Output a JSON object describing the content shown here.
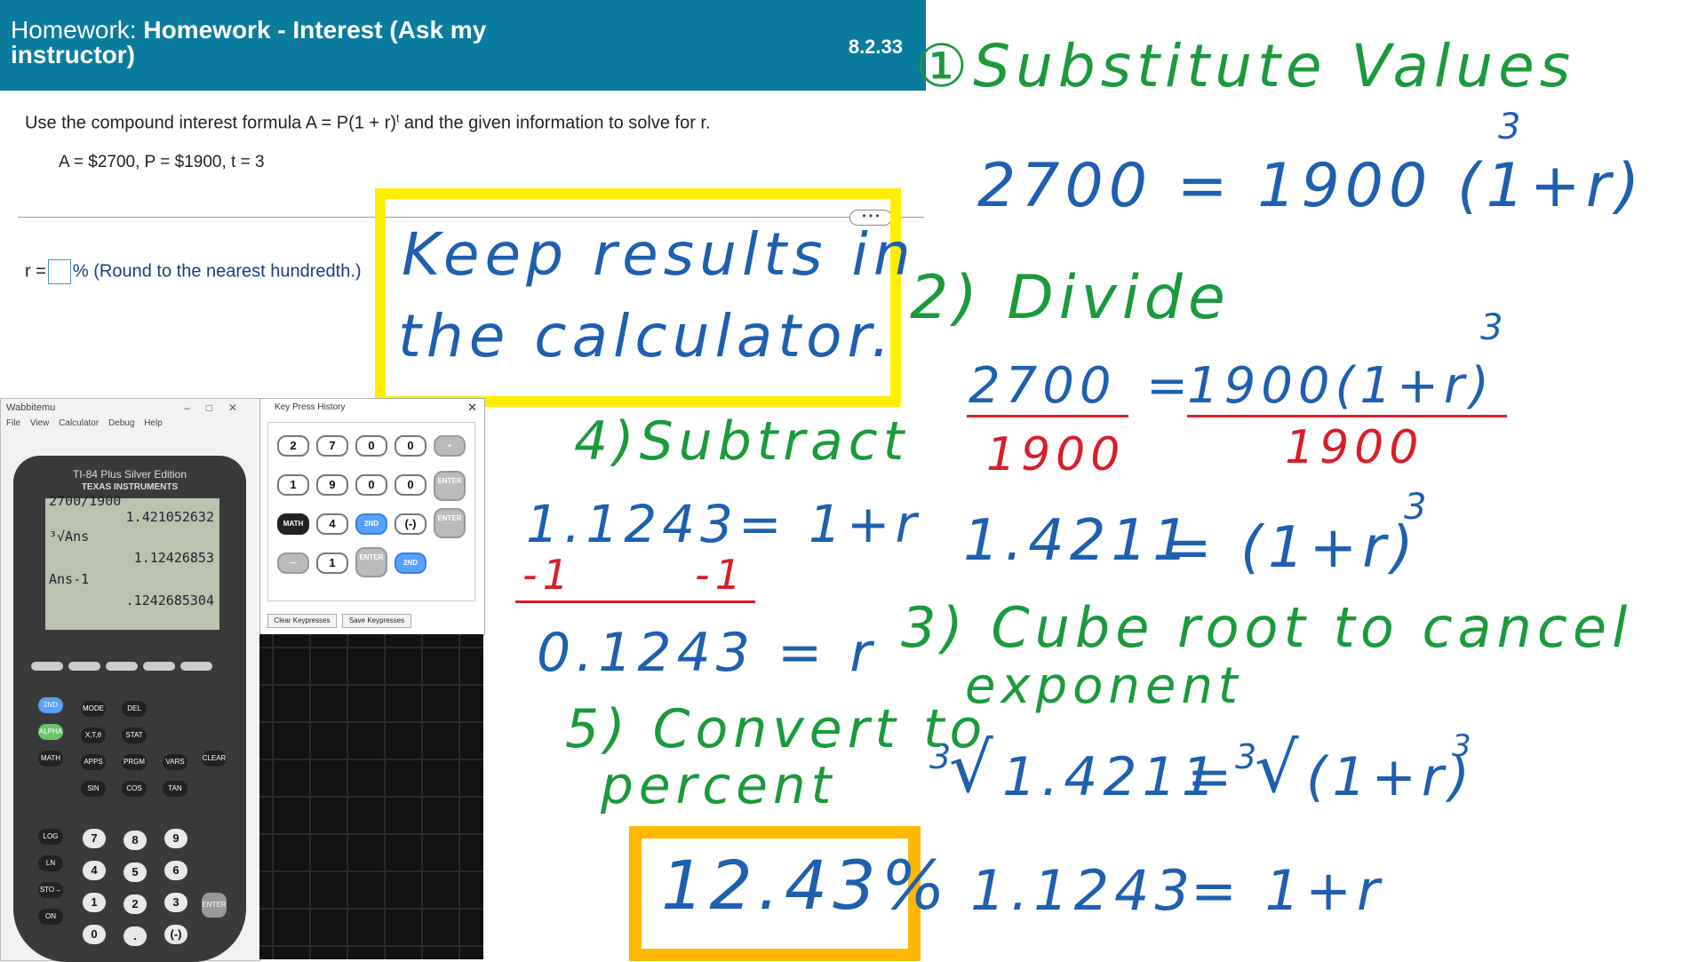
{
  "homework": {
    "label": "Homework:",
    "title_line1": "Homework - Interest (Ask my",
    "title_line2": "instructor)",
    "id": "8.2.33",
    "question_pre": "Use the compound interest formula A = P(1 + r)",
    "question_exp": "t",
    "question_post": " and the given information to solve for r.",
    "given": "A = $2700, P = $1900, t = 3",
    "more": "• • •",
    "answer_prefix": "r =",
    "answer_hint": "% (Round to the nearest hundredth.)"
  },
  "notes": {
    "step1": "①Substitute Values",
    "eq1": "2700 = 1900 (1+r)",
    "eq1_exp": "3",
    "step2": "2) Divide",
    "div_num_left": "2700",
    "div_den_left": "1900",
    "div_num_right": "1900(1+r)",
    "div_num_right_exp": "3",
    "div_den_right": "1900",
    "eq2_left": "1.4211",
    "eq2_right": "= (1+r)",
    "eq2_exp": "3",
    "step3_line1": "3) Cube root to cancel",
    "step3_line2": "exponent",
    "root_index": "3",
    "root_left": "1.4211",
    "root_eq": "=",
    "root_right": "(1+r)",
    "root_right_exp": "3",
    "eq3_left": "1.1243",
    "eq3_right": "= 1+r",
    "keep_line1": "Keep results in",
    "keep_line2": "the calculator.",
    "step4": "4)Subtract",
    "sub_eq": "1.1243= 1+r",
    "sub_left": "-1",
    "sub_right": "-1",
    "sub_result": "0.1243 = r",
    "step5_line1": "5) Convert to",
    "step5_line2": "percent",
    "result": "12.43%"
  },
  "calculator": {
    "window_title": "Wabbitemu",
    "menu": "File View Calculator Debug Help",
    "model": "TI-84 Plus Silver Edition",
    "brand": "TEXAS INSTRUMENTS",
    "screen": [
      {
        "left": "2700/1900",
        "right": ""
      },
      {
        "left": "",
        "right": "1.421052632"
      },
      {
        "left": "³√Ans",
        "right": ""
      },
      {
        "left": "",
        "right": "1.12426853"
      },
      {
        "left": "Ans-1",
        "right": ""
      },
      {
        "left": "",
        "right": ".1242685304"
      }
    ]
  },
  "key_history": {
    "window_title": "Key Press History",
    "row1": [
      "2",
      "7",
      "0",
      "0",
      "+"
    ],
    "row2": [
      "1",
      "9",
      "0",
      "0",
      "ENTER"
    ],
    "row3": [
      "MATH",
      "4",
      "2ND",
      "(-)",
      "ENTER"
    ],
    "row4": [
      "—",
      "1",
      "ENTER",
      "2ND"
    ],
    "clear_button": "Clear Keypresses",
    "save_button": "Save Keypresses"
  }
}
